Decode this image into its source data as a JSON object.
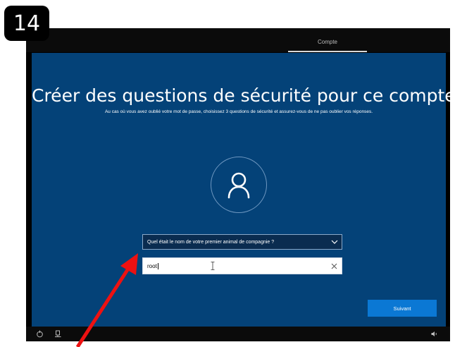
{
  "step_badge": "14",
  "topbar": {
    "active_tab": "Compte"
  },
  "setup": {
    "title": "Créer des questions de sécurité pour ce compte",
    "subtitle": "Au cas où vous avez oublié votre mot de passe, choisissez 3 questions de sécurité et assurez-vous de ne pas oublier vos réponses.",
    "avatar_icon": "user-icon",
    "question_select": {
      "selected": "Quel était le nom de votre premier animal de compagnie ?"
    },
    "answer_field": {
      "value": "root"
    },
    "next_button": "Suivant"
  },
  "bottombar": {
    "icons": [
      "accessibility-icon",
      "network-icon",
      "volume-icon"
    ]
  },
  "colors": {
    "panel_bg": "#044278",
    "primary_button": "#0b78d4",
    "annotation_arrow": "#ee1111"
  }
}
